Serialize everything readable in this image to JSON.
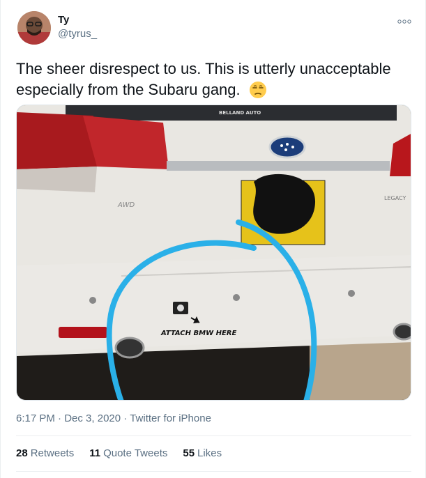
{
  "author": {
    "name": "Ty",
    "handle": "@tyrus_"
  },
  "more_icon": "ellipsis-icon",
  "tweet": {
    "text": "The sheer disrespect to us. This is utterly unacceptable especially from the Subaru gang.",
    "emoji": "unamused-face"
  },
  "photo": {
    "badge_text": "AWD",
    "dealer_text": "BELLAND AUTO",
    "sticker_text": "ATTACH BMW HERE",
    "model_text": "LEGACY"
  },
  "meta": {
    "time": "6:17 PM",
    "sep1": "·",
    "date": "Dec 3, 2020",
    "sep2": "·",
    "source": "Twitter for iPhone"
  },
  "stats": {
    "retweets_count": "28",
    "retweets_label": "Retweets",
    "quotes_count": "11",
    "quotes_label": "Quote Tweets",
    "likes_count": "55",
    "likes_label": "Likes"
  }
}
